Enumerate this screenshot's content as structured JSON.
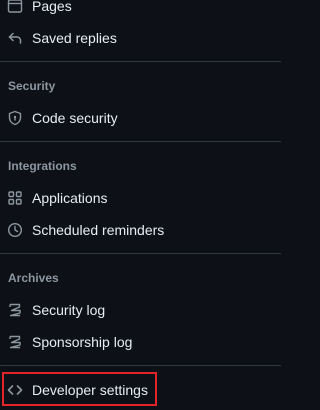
{
  "sidebar": {
    "top_items": [
      {
        "label": "Pages",
        "icon": "browser-icon"
      },
      {
        "label": "Saved replies",
        "icon": "reply-icon"
      }
    ],
    "sections": [
      {
        "heading": "Security",
        "items": [
          {
            "label": "Code security",
            "icon": "shield-lock-icon"
          }
        ]
      },
      {
        "heading": "Integrations",
        "items": [
          {
            "label": "Applications",
            "icon": "apps-icon"
          },
          {
            "label": "Scheduled reminders",
            "icon": "clock-icon"
          }
        ]
      },
      {
        "heading": "Archives",
        "items": [
          {
            "label": "Security log",
            "icon": "log-icon"
          },
          {
            "label": "Sponsorship log",
            "icon": "log-icon"
          }
        ]
      }
    ],
    "bottom_items": [
      {
        "label": "Developer settings",
        "icon": "code-icon",
        "highlighted": true
      }
    ]
  },
  "colors": {
    "background": "#0d1117",
    "text": "#e6edf3",
    "muted": "#8d96a0",
    "divider": "#30363d",
    "highlight_border": "#e3242b"
  }
}
